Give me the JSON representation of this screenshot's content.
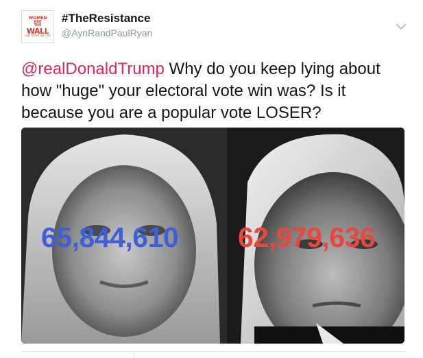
{
  "user": {
    "display_name": "#TheResistance",
    "handle": "@AynRandPaulRyan",
    "avatar_text": {
      "line1": "WOMEN",
      "line2": "ARE",
      "line3": "THE",
      "line4": "WALL",
      "line5": "AND TRUMP WILL PAY"
    }
  },
  "tweet": {
    "mention": "@realDonaldTrump",
    "text": " Why do you keep lying about how \"huge\" your electoral vote win was? Is it because you are a popular vote LOSER?"
  },
  "media": {
    "left_number": "65,844,610",
    "right_number": "62,979,636",
    "left_color": "#3d5fd8",
    "right_color": "#e8483b"
  },
  "icons": {
    "menu": "chevron-down-icon"
  }
}
